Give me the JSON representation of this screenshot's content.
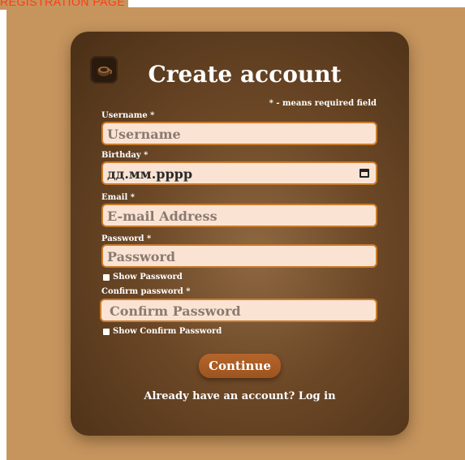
{
  "page_label": "REGISTRATION PAGE",
  "form": {
    "title": "Create account",
    "required_note": "* - means required field",
    "username_label": "Username *",
    "username_placeholder": "Username",
    "birthday_label": "Birthday *",
    "birthday_placeholder": "дд.мм.рррр",
    "email_label": "Email *",
    "email_placeholder": "E-mail Address",
    "password_label": "Password *",
    "password_placeholder": "Password",
    "show_password_label": "Show Password",
    "confirm_label": "Confirm password *",
    "confirm_placeholder": "Confirm Password",
    "show_confirm_label": "Show Confirm Password",
    "continue_label": "Continue",
    "login_text": "Already have an account? Log in"
  },
  "colors": {
    "page_bg": "#c6955e",
    "card_dark": "#4a2f16",
    "field_bg": "#fbe3d3",
    "field_border": "#c97b2c",
    "button": "#a85b24",
    "label_accent": "#ff3a14"
  },
  "icons": {
    "logo": "coffee-cup-icon",
    "calendar": "calendar-icon"
  }
}
